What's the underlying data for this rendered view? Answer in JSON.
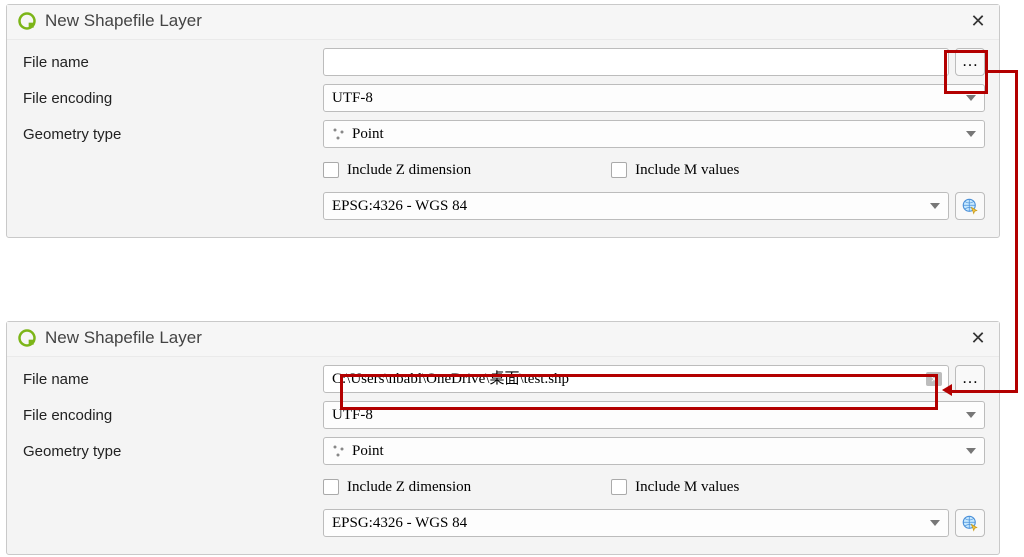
{
  "annotations": {
    "highlight_browse_button": true,
    "highlight_filename_filled": true,
    "arrows_from_browse_to_filename": true
  },
  "dialog_top": {
    "title": "New Shapefile Layer",
    "filename_label": "File name",
    "filename_value": "",
    "browse_button": "…",
    "encoding_label": "File encoding",
    "encoding_value": "UTF-8",
    "geom_label": "Geometry type",
    "geom_value": "Point",
    "check_z": "Include Z dimension",
    "check_m": "Include M values",
    "crs_value": "EPSG:4326 - WGS 84"
  },
  "dialog_bottom": {
    "title": "New Shapefile Layer",
    "filename_label": "File name",
    "filename_value": "C:\\Users\\nbabl\\OneDrive\\桌面\\test.shp",
    "browse_button": "…",
    "encoding_label": "File encoding",
    "encoding_value": "UTF-8",
    "geom_label": "Geometry type",
    "geom_value": "Point",
    "check_z": "Include Z dimension",
    "check_m": "Include M values",
    "crs_value": "EPSG:4326 - WGS 84"
  }
}
